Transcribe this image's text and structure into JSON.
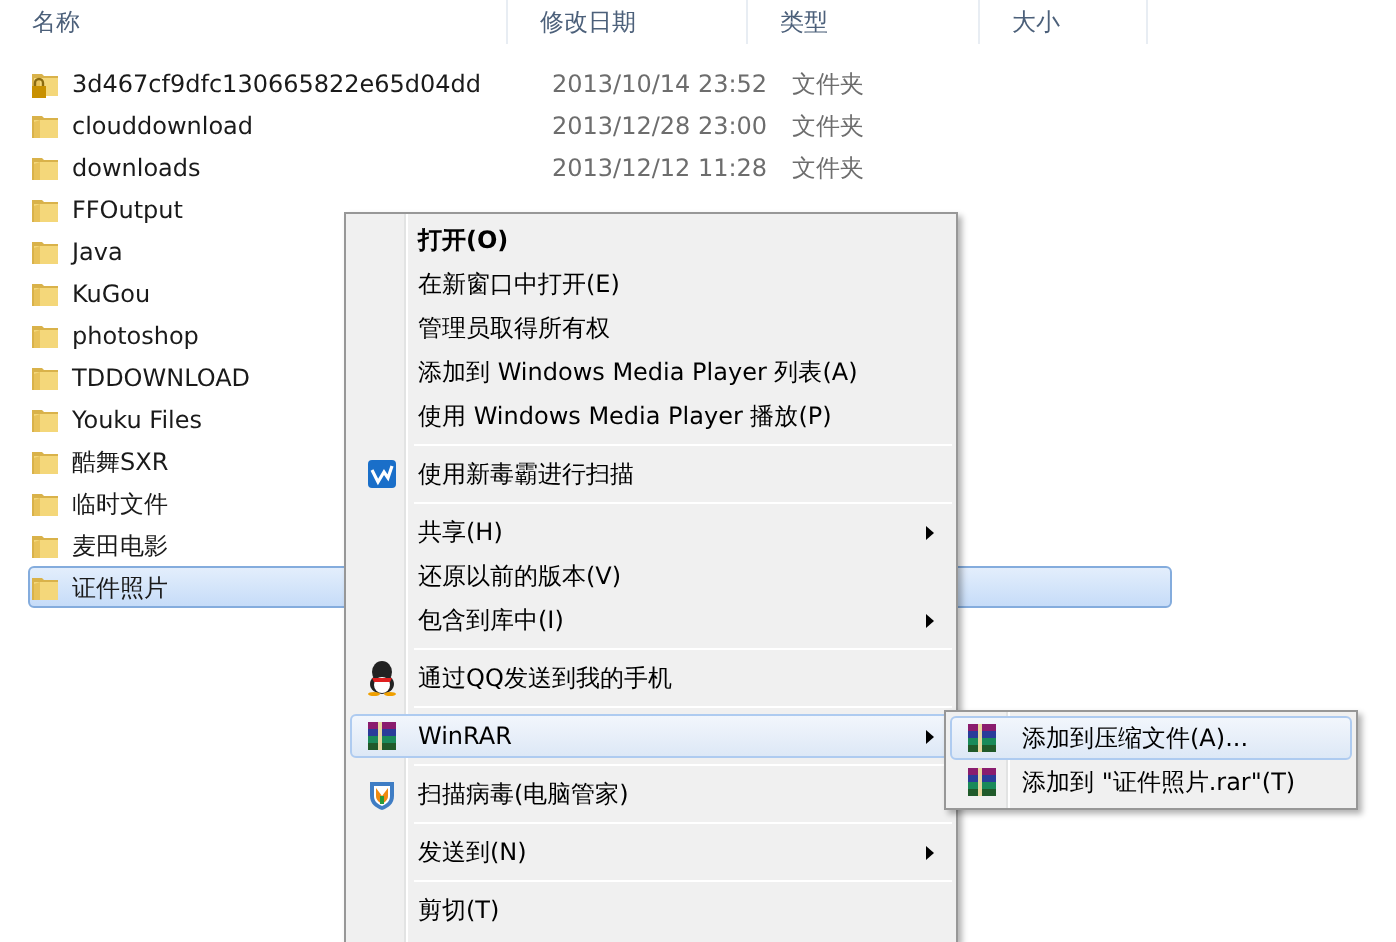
{
  "columns": [
    {
      "label": "名称"
    },
    {
      "label": "修改日期"
    },
    {
      "label": "类型"
    },
    {
      "label": "大小"
    }
  ],
  "files": [
    {
      "name": "3d467cf9dfc130665822e65d04dd",
      "date": "2013/10/14 23:52",
      "type": "文件夹",
      "locked": true,
      "selected": false
    },
    {
      "name": "clouddownload",
      "date": "2013/12/28 23:00",
      "type": "文件夹",
      "locked": false,
      "selected": false
    },
    {
      "name": "downloads",
      "date": "2013/12/12 11:28",
      "type": "文件夹",
      "locked": false,
      "selected": false
    },
    {
      "name": "FFOutput",
      "locked": false,
      "selected": false
    },
    {
      "name": "Java",
      "locked": false,
      "selected": false
    },
    {
      "name": "KuGou",
      "locked": false,
      "selected": false
    },
    {
      "name": "photoshop",
      "locked": false,
      "selected": false
    },
    {
      "name": "TDDOWNLOAD",
      "locked": false,
      "selected": false
    },
    {
      "name": "Youku Files",
      "locked": false,
      "selected": false
    },
    {
      "name": "酷舞SXR",
      "locked": false,
      "selected": false
    },
    {
      "name": "临时文件",
      "locked": false,
      "selected": false
    },
    {
      "name": "麦田电影",
      "locked": false,
      "selected": false
    },
    {
      "name": "证件照片",
      "locked": false,
      "selected": true
    }
  ],
  "context_menu": [
    {
      "kind": "plain",
      "label": "打开(O)",
      "bold": true,
      "submenu": false,
      "selected": false
    },
    {
      "kind": "plain",
      "label": "在新窗口中打开(E)",
      "bold": false,
      "submenu": false,
      "selected": false
    },
    {
      "kind": "plain",
      "label": "管理员取得所有权",
      "bold": false,
      "submenu": false,
      "selected": false
    },
    {
      "kind": "plain",
      "label": "添加到 Windows Media Player 列表(A)",
      "bold": false,
      "submenu": false,
      "selected": false
    },
    {
      "kind": "plain",
      "label": "使用 Windows Media Player 播放(P)",
      "bold": false,
      "submenu": false,
      "selected": false
    },
    {
      "kind": "separator"
    },
    {
      "kind": "scan",
      "label": "使用新毒霸进行扫描",
      "bold": false,
      "submenu": false,
      "selected": false
    },
    {
      "kind": "separator"
    },
    {
      "kind": "plain",
      "label": "共享(H)",
      "bold": false,
      "submenu": true,
      "selected": false
    },
    {
      "kind": "plain",
      "label": "还原以前的版本(V)",
      "bold": false,
      "submenu": false,
      "selected": false
    },
    {
      "kind": "plain",
      "label": "包含到库中(I)",
      "bold": false,
      "submenu": true,
      "selected": false
    },
    {
      "kind": "separator"
    },
    {
      "kind": "qq",
      "label": "通过QQ发送到我的手机",
      "bold": false,
      "submenu": false,
      "selected": false
    },
    {
      "kind": "separator"
    },
    {
      "kind": "archive",
      "label": "WinRAR",
      "bold": false,
      "submenu": true,
      "selected": true
    },
    {
      "kind": "separator"
    },
    {
      "kind": "shield",
      "label": "扫描病毒(电脑管家)",
      "bold": false,
      "submenu": false,
      "selected": false
    },
    {
      "kind": "separator"
    },
    {
      "kind": "plain",
      "label": "发送到(N)",
      "bold": false,
      "submenu": true,
      "selected": false
    },
    {
      "kind": "separator"
    },
    {
      "kind": "plain",
      "label": "剪切(T)",
      "bold": false,
      "submenu": false,
      "selected": false
    }
  ],
  "submenu": [
    {
      "kind": "archive",
      "label": "添加到压缩文件(A)...",
      "selected": true
    },
    {
      "kind": "archive",
      "label": "添加到 \"证件照片.rar\"(T)",
      "selected": false
    }
  ]
}
